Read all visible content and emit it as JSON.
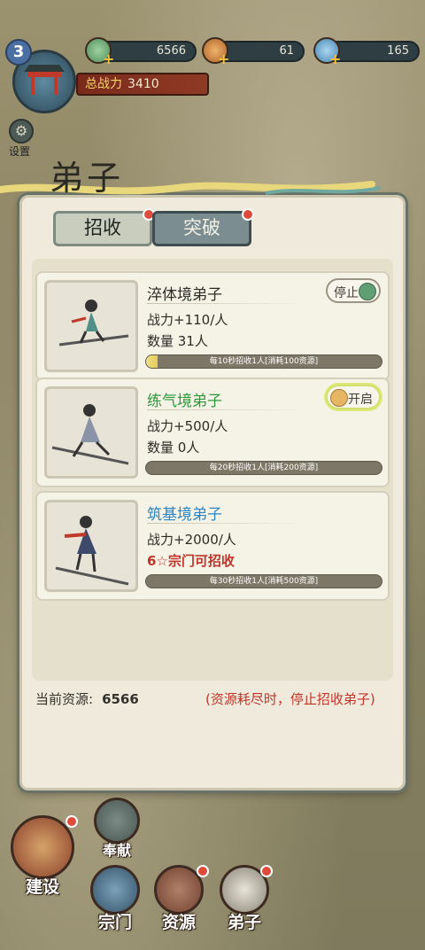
{
  "top": {
    "level": "3",
    "resources": [
      {
        "name": "jade",
        "icon": "jade-icon",
        "value": "6566"
      },
      {
        "name": "gourd",
        "icon": "gourd-icon",
        "value": "61"
      },
      {
        "name": "crystal",
        "icon": "crystal-icon",
        "value": "165"
      }
    ],
    "power_label": "总战力",
    "power_value": "3410",
    "settings_label": "设置"
  },
  "panel": {
    "title": "弟子",
    "tabs": [
      {
        "label": "招收",
        "active": false,
        "has_dot": true
      },
      {
        "label": "突破",
        "active": true,
        "has_dot": true
      }
    ],
    "cards": [
      {
        "name": "淬体境弟子",
        "name_color": "default",
        "power": "战力+110/人",
        "count": "数量 31人",
        "count_red": false,
        "toggle_label": "停止",
        "toggle_state": "off",
        "progress": 0.05,
        "bar_text": "每10秒招收1人[消耗100资源]"
      },
      {
        "name": "练气境弟子",
        "name_color": "green",
        "power": "战力+500/人",
        "count": "数量 0人",
        "count_red": false,
        "toggle_label": "开启",
        "toggle_state": "on",
        "progress": 0.0,
        "bar_text": "每20秒招收1人[消耗200资源]"
      },
      {
        "name": "筑基境弟子",
        "name_color": "blue",
        "power": "战力+2000/人",
        "count": "6☆宗门可招收",
        "count_red": true,
        "toggle_label": "",
        "toggle_state": "none",
        "progress": 0.0,
        "bar_text": "每30秒招收1人[消耗500资源]"
      }
    ],
    "current_resource_label": "当前资源:",
    "current_resource_value": "6566",
    "warning": "(资源耗尽时，停止招收弟子)"
  },
  "nav": {
    "items": [
      {
        "label": "奉献",
        "icon": "heart-icon"
      },
      {
        "label": "建设",
        "icon": "build-icon"
      },
      {
        "label": "宗门",
        "icon": "sect-icon"
      },
      {
        "label": "资源",
        "icon": "resource-icon"
      },
      {
        "label": "弟子",
        "icon": "disciple-icon"
      }
    ]
  }
}
